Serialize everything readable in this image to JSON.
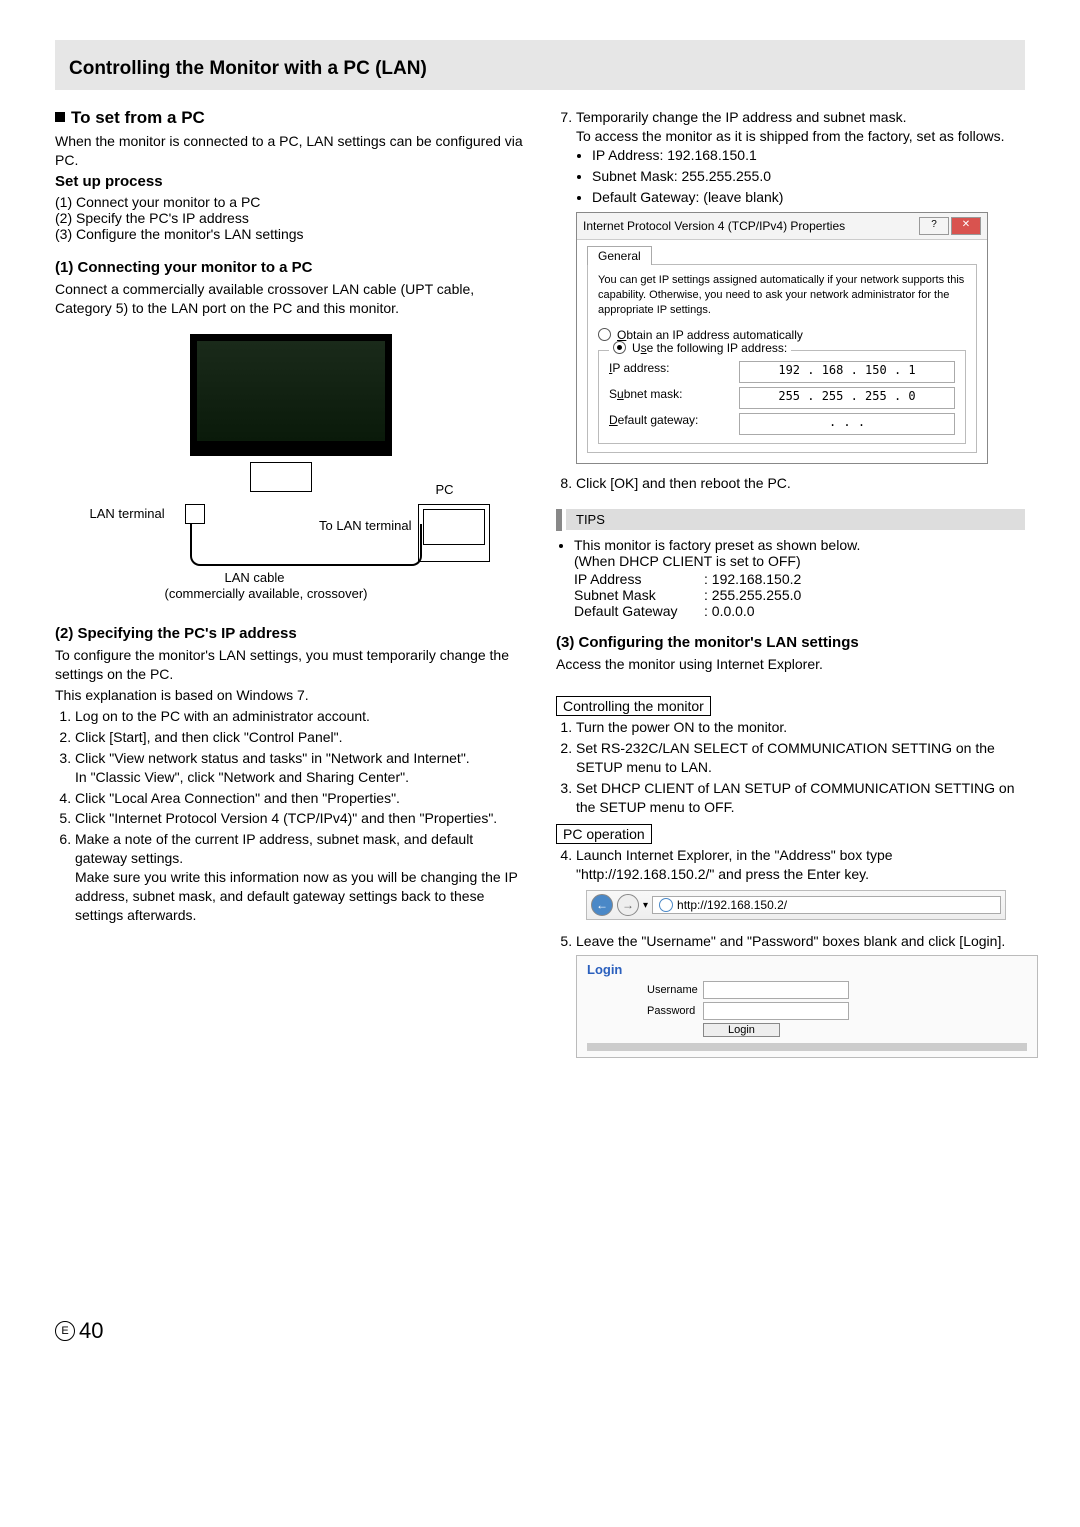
{
  "header": {
    "title": "Controlling the Monitor with a PC (LAN)"
  },
  "left": {
    "section_title": "To set from a PC",
    "intro": "When the monitor is connected to a PC, LAN settings can be configured via PC.",
    "setup_heading": "Set up process",
    "setup_steps": [
      "(1) Connect your monitor to a PC",
      "(2) Specify the PC's IP address",
      "(3) Configure the monitor's LAN settings"
    ],
    "step1_heading": "(1) Connecting your monitor to a PC",
    "step1_body": "Connect a commercially available crossover LAN cable (UPT cable, Category 5) to the LAN  port on the PC and this monitor.",
    "diagram": {
      "lan_terminal": "LAN terminal",
      "pc": "PC",
      "to_lan": "To LAN terminal",
      "lan_cable": "LAN cable",
      "lan_cable_desc": "(commercially available, crossover)"
    },
    "step2_heading": "(2) Specifying the PC's IP address",
    "step2_intro1": "To configure the monitor's LAN settings, you must temporarily change the settings on the PC.",
    "step2_intro2": "This explanation is based on Windows 7.",
    "step2_list": [
      "Log on to the PC with an administrator account.",
      "Click [Start], and then click \"Control Panel\".",
      "Click \"View network status and tasks\" in \"Network and Internet\".",
      "Click \"Local Area Connection\" and then \"Properties\".",
      "Click \"Internet Protocol Version 4 (TCP/IPv4)\" and then \"Properties\".",
      "Make a note of the current IP address, subnet mask, and default gateway settings."
    ],
    "step2_classic": "In \"Classic View\", click \"Network and Sharing Center\".",
    "step2_note": "Make sure you write this information now as you will be changing the IP address, subnet mask, and default gateway settings back to these settings afterwards."
  },
  "right": {
    "step7_intro": "Temporarily change the IP address and subnet mask.",
    "step7_body": "To access the monitor as it is shipped from the factory, set as follows.",
    "step7_bullets": [
      "IP Address: 192.168.150.1",
      "Subnet Mask: 255.255.255.0",
      "Default Gateway: (leave blank)"
    ],
    "dialog": {
      "title": "Internet Protocol Version 4 (TCP/IPv4) Properties",
      "tab": "General",
      "desc": "You can get IP settings assigned automatically if your network supports this capability. Otherwise, you need to ask your network administrator for the appropriate IP settings.",
      "radio_auto": "Obtain an IP address automatically",
      "radio_manual": "Use the following IP address:",
      "ip_label": "IP address:",
      "ip_value": "192 . 168 . 150 .   1",
      "subnet_label": "Subnet mask:",
      "subnet_value": "255 . 255 . 255 .   0",
      "gateway_label": "Default gateway:",
      "gateway_value": ".       .       ."
    },
    "step8": "Click [OK] and then reboot the PC.",
    "tips_label": "TIPS",
    "tips_line1": "This monitor is factory preset as shown below.",
    "tips_line2": "(When DHCP CLIENT is set to OFF)",
    "tips_table": [
      {
        "k": "IP Address",
        "v": ": 192.168.150.2"
      },
      {
        "k": "Subnet Mask",
        "v": ": 255.255.255.0"
      },
      {
        "k": "Default Gateway",
        "v": ": 0.0.0.0"
      }
    ],
    "step3_heading": "(3) Configuring the monitor's LAN settings",
    "step3_intro": "Access the monitor using Internet Explorer.",
    "controlling_label": "Controlling the monitor",
    "controlling_list": [
      "Turn the power ON to the monitor.",
      "Set RS-232C/LAN SELECT of COMMUNICATION SETTING on the SETUP menu to LAN.",
      "Set DHCP CLIENT of LAN SETUP of COMMUNICATION SETTING on the SETUP menu to OFF."
    ],
    "pc_op_label": "PC operation",
    "pc_op_step4": "Launch Internet Explorer, in the \"Address\" box type \"http://192.168.150.2/\" and press the Enter key.",
    "url": "http://192.168.150.2/",
    "pc_op_step5": "Leave the \"Username\" and \"Password\" boxes blank and click [Login].",
    "login": {
      "title": "Login",
      "user": "Username",
      "pass": "Password",
      "btn": "Login"
    }
  },
  "page_number": "40",
  "page_e": "E"
}
